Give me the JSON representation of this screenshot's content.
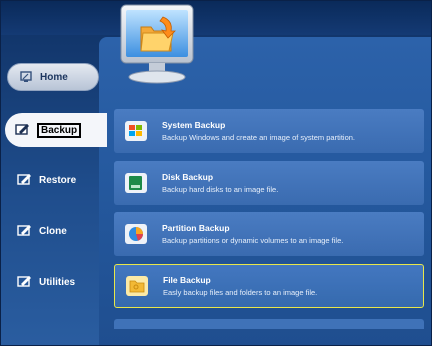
{
  "sidebar": {
    "items": [
      {
        "label": "Home",
        "icon": "home-icon"
      },
      {
        "label": "Backup",
        "icon": "backup-icon"
      },
      {
        "label": "Restore",
        "icon": "restore-icon"
      },
      {
        "label": "Clone",
        "icon": "clone-icon"
      },
      {
        "label": "Utilities",
        "icon": "utilities-icon"
      }
    ]
  },
  "cards": [
    {
      "title": "System Backup",
      "desc": "Backup Windows and create an image of system partition.",
      "icon": "windows-logo-icon"
    },
    {
      "title": "Disk Backup",
      "desc": "Backup hard disks to an image file.",
      "icon": "disk-icon"
    },
    {
      "title": "Partition Backup",
      "desc": "Backup partitions or dynamic volumes to an image file.",
      "icon": "partition-pie-icon"
    },
    {
      "title": "File Backup",
      "desc": "Easly backup files and folders to an image file.",
      "icon": "folder-icon"
    }
  ],
  "colors": {
    "accent": "#e8e74a",
    "panel": "#2c62aa",
    "card": "#4a7cc2",
    "background": "#1b3e73"
  }
}
